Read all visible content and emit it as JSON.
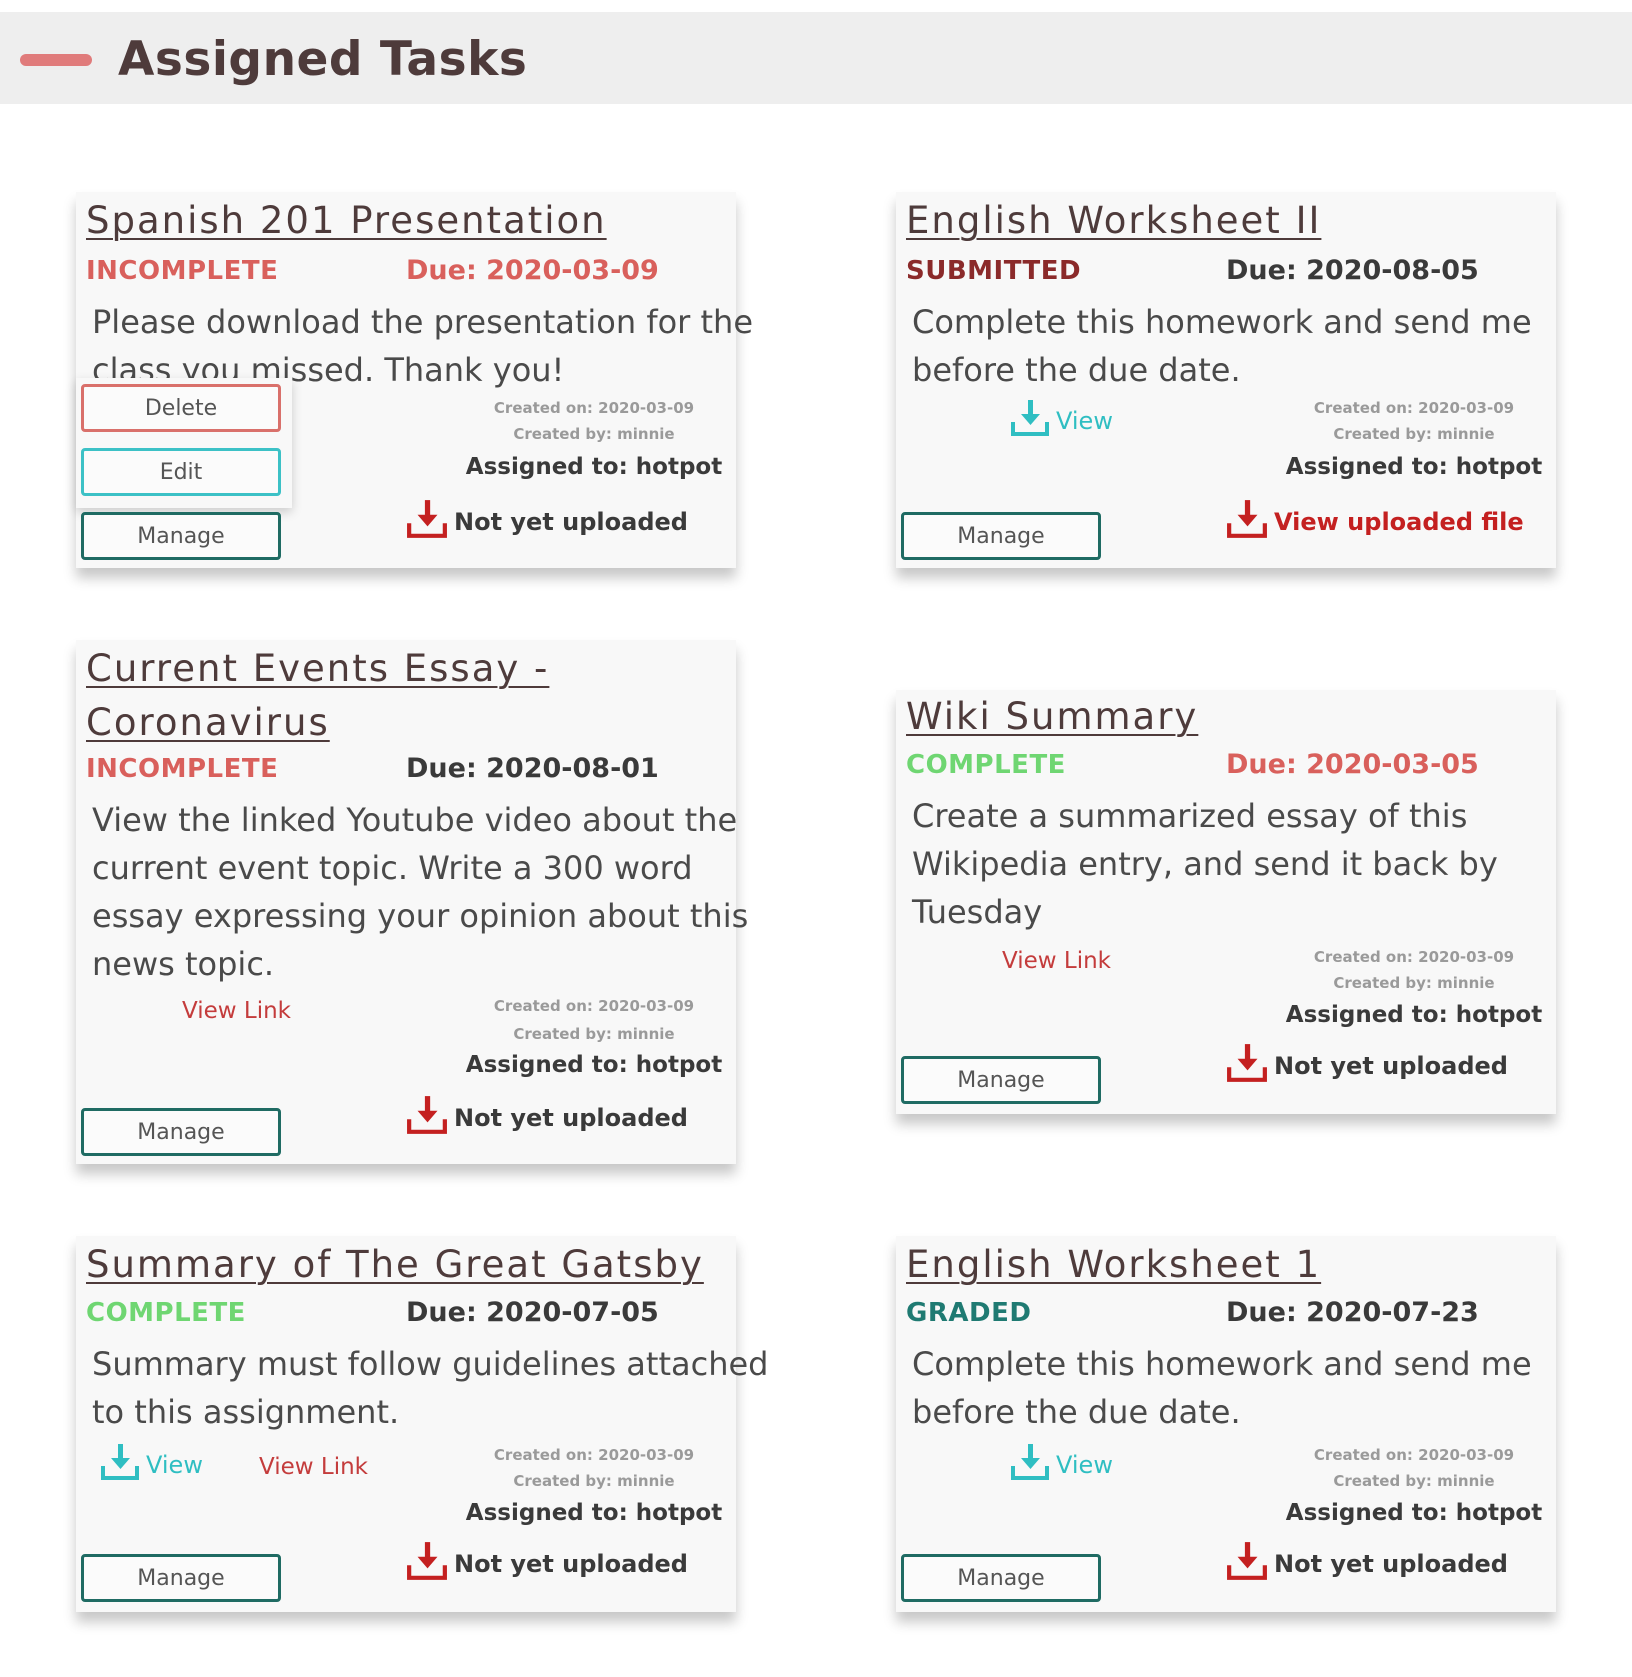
{
  "header": {
    "title": "Assigned Tasks",
    "accent_color": "#e07b7b"
  },
  "colors": {
    "title": "#4e3b3b",
    "status_incomplete": "#d9605c",
    "status_submitted": "#8b2a2a",
    "status_complete": "#6fd672",
    "status_graded": "#1f7a72",
    "due_overdue": "#d9605c",
    "due_normal": "#3a3a3a",
    "manage_border": "#1f6b63",
    "view_link": "#c43c3c",
    "view_file": "#2fbec2",
    "upload_icon": "#c42020"
  },
  "cards": [
    {
      "title_lines": [
        "Spanish 201 Presentation"
      ],
      "status": "INCOMPLETE",
      "due": "Due: 2020-03-09",
      "description_lines": [
        "Please download the presentation for the",
        "class you missed. Thank you!"
      ],
      "created_on": "Created on: 2020-03-09",
      "created_by": "Created by: minnie",
      "assigned_to": "Assigned to: hotpot",
      "upload_text": "Not yet uploaded",
      "manage_label": "Manage",
      "menu": {
        "delete_label": "Delete",
        "edit_label": "Edit"
      }
    },
    {
      "title_lines": [
        "English Worksheet II"
      ],
      "status": "SUBMITTED",
      "due": "Due: 2020-08-05",
      "description_lines": [
        "Complete this homework and send me",
        "before the due date."
      ],
      "view_file_label": "View",
      "created_on": "Created on: 2020-03-09",
      "created_by": "Created by: minnie",
      "assigned_to": "Assigned to: hotpot",
      "upload_text": "View uploaded file",
      "manage_label": "Manage"
    },
    {
      "title_lines": [
        "Current Events Essay -",
        "Coronavirus"
      ],
      "status": "INCOMPLETE",
      "due": "Due: 2020-08-01",
      "description_lines": [
        "View the linked Youtube video about the",
        "current event topic. Write a 300 word",
        "essay expressing your opinion about this",
        "news topic."
      ],
      "view_link_label": "View Link",
      "created_on": "Created on: 2020-03-09",
      "created_by": "Created by: minnie",
      "assigned_to": "Assigned to: hotpot",
      "upload_text": "Not yet uploaded",
      "manage_label": "Manage"
    },
    {
      "title_lines": [
        "Wiki Summary"
      ],
      "status": "COMPLETE",
      "due": "Due: 2020-03-05",
      "description_lines": [
        "Create a summarized essay of this",
        "Wikipedia entry, and send it back by",
        "Tuesday"
      ],
      "view_link_label": "View Link",
      "created_on": "Created on: 2020-03-09",
      "created_by": "Created by: minnie",
      "assigned_to": "Assigned to: hotpot",
      "upload_text": "Not yet uploaded",
      "manage_label": "Manage"
    },
    {
      "title_lines": [
        "Summary of The Great Gatsby"
      ],
      "status": "COMPLETE",
      "due": "Due: 2020-07-05",
      "description_lines": [
        "Summary must follow guidelines attached",
        "to this assignment."
      ],
      "view_file_label": "View",
      "view_link_label": "View Link",
      "created_on": "Created on: 2020-03-09",
      "created_by": "Created by: minnie",
      "assigned_to": "Assigned to: hotpot",
      "upload_text": "Not yet uploaded",
      "manage_label": "Manage"
    },
    {
      "title_lines": [
        "English Worksheet 1"
      ],
      "status": "GRADED",
      "due": "Due: 2020-07-23",
      "description_lines": [
        "Complete this homework and send me",
        "before the due date."
      ],
      "view_file_label": "View",
      "created_on": "Created on: 2020-03-09",
      "created_by": "Created by: minnie",
      "assigned_to": "Assigned to: hotpot",
      "upload_text": "Not yet uploaded",
      "manage_label": "Manage"
    }
  ]
}
